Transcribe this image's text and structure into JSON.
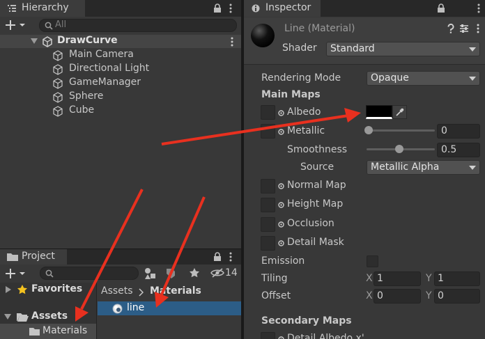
{
  "hierarchy": {
    "tab_label": "Hierarchy",
    "search_placeholder": "All",
    "scene": "DrawCurve",
    "items": [
      "Main Camera",
      "Directional Light",
      "GameManager",
      "Sphere",
      "Cube"
    ]
  },
  "project": {
    "tab_label": "Project",
    "hidden_count": "14",
    "favorites": "Favorites",
    "assets": "Assets",
    "materials_folder": "Materials",
    "breadcrumb": [
      "Assets",
      "Materials"
    ],
    "files": [
      "line"
    ]
  },
  "inspector": {
    "tab_label": "Inspector",
    "material_title": "Line (Material)",
    "shader_label": "Shader",
    "shader_value": "Standard",
    "rendering_mode_label": "Rendering Mode",
    "rendering_mode_value": "Opaque",
    "main_maps": "Main Maps",
    "albedo": "Albedo",
    "metallic": "Metallic",
    "metallic_value": "0",
    "smoothness": "Smoothness",
    "smoothness_value": "0.5",
    "source_label": "Source",
    "source_value": "Metallic Alpha",
    "normal_map": "Normal Map",
    "height_map": "Height Map",
    "occlusion": "Occlusion",
    "detail_mask": "Detail Mask",
    "emission": "Emission",
    "tiling": "Tiling",
    "offset": "Offset",
    "tiling_x": "1",
    "tiling_y": "1",
    "offset_x": "0",
    "offset_y": "0",
    "x_label": "X",
    "y_label": "Y",
    "secondary_maps": "Secondary Maps",
    "detail_albedo": "Detail Albedo x'"
  },
  "colors": {
    "selection": "#2c5d87",
    "arrow": "#e8301f",
    "albedo_swatch": "#000000"
  }
}
